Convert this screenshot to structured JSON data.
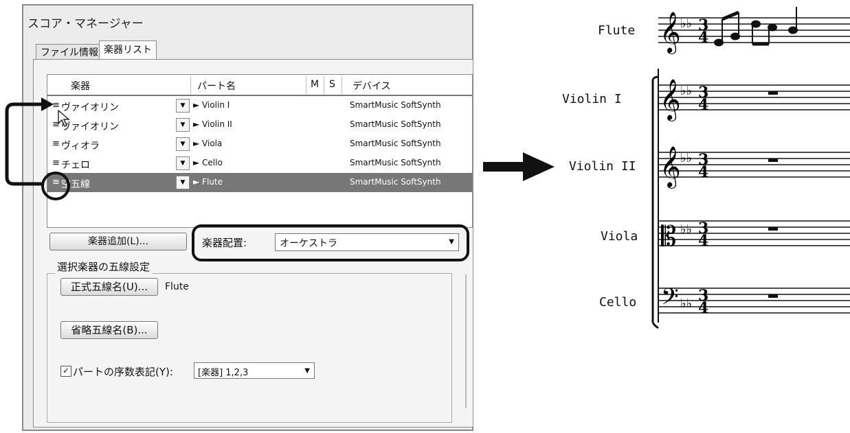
{
  "window": {
    "title": "スコア・マネージャー",
    "tabs": [
      "ファイル情報",
      "楽器リスト"
    ],
    "active_tab": "楽器リスト"
  },
  "instrument_list": {
    "headers": {
      "instrument": "楽器",
      "part": "パート名",
      "m": "M",
      "s": "S",
      "device": "デバイス"
    },
    "rows": [
      {
        "handle": "≡",
        "instrument": "ヴァイオリン",
        "part": "► Violin I",
        "device": "SmartMusic SoftSynth",
        "selected": false
      },
      {
        "handle": "≡",
        "instrument": "ヴァイオリン",
        "part": "► Violin II",
        "device": "SmartMusic SoftSynth",
        "selected": false
      },
      {
        "handle": "≡",
        "instrument": "ヴィオラ",
        "part": "► Viola",
        "device": "SmartMusic SoftSynth",
        "selected": false
      },
      {
        "handle": "≡",
        "instrument": "チェロ",
        "part": "► Cello",
        "device": "SmartMusic SoftSynth",
        "selected": false
      },
      {
        "handle": "≡",
        "instrument": "空五線",
        "part": "► Flute",
        "device": "SmartMusic SoftSynth",
        "selected": true
      }
    ]
  },
  "controls": {
    "add_instrument": "楽器追加(L)...",
    "placement_label": "楽器配置:",
    "placement_value": "オーケストラ"
  },
  "staff_settings": {
    "group_label": "選択楽器の五線設定",
    "full_name_button": "正式五線名(U)...",
    "full_name_value": "Flute",
    "abbr_name_button": "省略五線名(B)...",
    "ordinal_checkbox_label": "パートの序数表記(Y):",
    "ordinal_checked": true,
    "ordinal_value": "[楽器] 1,2,3"
  },
  "score": {
    "staves": [
      "Flute",
      "Violin I",
      "Violin II",
      "Viola",
      "Cello"
    ],
    "key_signature": "♭♭",
    "time_signature": {
      "top": "3",
      "bottom": "4"
    },
    "clefs": [
      "treble-clef",
      "treble-clef",
      "treble-clef",
      "alto-clef",
      "bass-clef"
    ]
  }
}
